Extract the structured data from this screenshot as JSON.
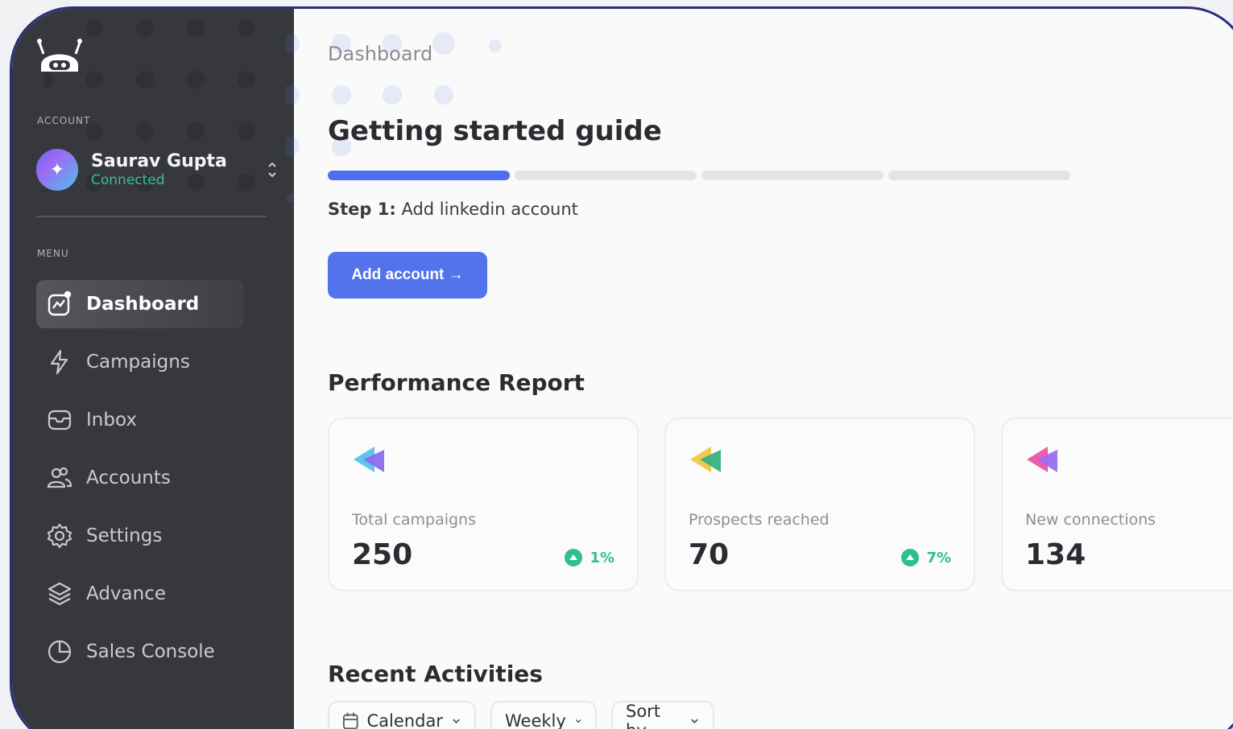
{
  "sidebar": {
    "account_label": "ACCOUNT",
    "account": {
      "name": "Saurav Gupta",
      "status": "Connected",
      "avatar_icon": "sparkle-icon"
    },
    "menu_label": "MENU",
    "items": [
      {
        "label": "Dashboard",
        "icon": "chart-icon",
        "active": true
      },
      {
        "label": "Campaigns",
        "icon": "lightning-icon",
        "active": false
      },
      {
        "label": "Inbox",
        "icon": "inbox-icon",
        "active": false
      },
      {
        "label": "Accounts",
        "icon": "users-icon",
        "active": false
      },
      {
        "label": "Settings",
        "icon": "gear-icon",
        "active": false
      },
      {
        "label": "Advance",
        "icon": "layers-icon",
        "active": false
      },
      {
        "label": "Sales Console",
        "icon": "pie-chart-icon",
        "active": false
      }
    ]
  },
  "main": {
    "breadcrumb": "Dashboard",
    "guide": {
      "title": "Getting started guide",
      "progress": {
        "completed_steps": 1,
        "total_steps": 4
      },
      "step_prefix": "Step 1:",
      "step_text": " Add linkedin account",
      "button_label": "Add account →"
    },
    "performance": {
      "title": "Performance Report",
      "cards": [
        {
          "label": "Total campaigns",
          "value": "250",
          "trend": "1%",
          "icon_colors": [
            "#5ec6ea",
            "#8e6cf0"
          ]
        },
        {
          "label": "Prospects reached",
          "value": "70",
          "trend": "7%",
          "icon_colors": [
            "#f2c94c",
            "#36b37e"
          ]
        },
        {
          "label": "New connections",
          "value": "134",
          "trend": "",
          "icon_colors": [
            "#ef5da8",
            "#9b6cf0"
          ]
        }
      ]
    },
    "activities": {
      "title": "Recent Activities",
      "filters": {
        "calendar": "Calendar",
        "period": "Weekly",
        "sort": "Sort by"
      }
    }
  },
  "colors": {
    "sidebar_bg": "#37383d",
    "accent": "#5273ec",
    "success": "#2fbf8d",
    "frame_border": "#2b2f7a"
  }
}
